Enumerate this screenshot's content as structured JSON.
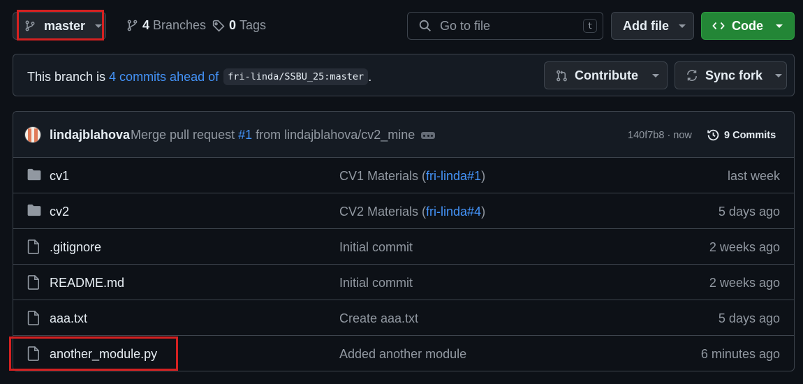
{
  "branch_selector": {
    "name": "master",
    "icon": "git-branch-icon"
  },
  "stats": {
    "branches": {
      "count": "4",
      "label": "Branches",
      "icon": "git-branch-icon"
    },
    "tags": {
      "count": "0",
      "label": "Tags",
      "icon": "tag-icon"
    }
  },
  "search": {
    "placeholder": "Go to file",
    "shortcut": "t",
    "icon": "search-icon"
  },
  "actions": {
    "add_file": "Add file",
    "code": "Code"
  },
  "ahead_banner": {
    "prefix": "This branch is",
    "link": "4 commits ahead of",
    "upstream": "fri-linda/SSBU_25:master",
    "suffix": ".",
    "contribute": "Contribute",
    "sync_fork": "Sync fork"
  },
  "latest_commit": {
    "author": "lindajblahova",
    "message_prefix": "Merge pull request",
    "pr": "#1",
    "message_suffix": "from lindajblahova/cv2_mine",
    "sha_time": "140f7b8 · now",
    "commits_count": "9 Commits"
  },
  "files": [
    {
      "type": "folder",
      "icon": "folder-icon",
      "name": "cv1",
      "msg_prefix": "CV1 Materials (",
      "msg_ref": "fri-linda#1",
      "msg_suffix": ")",
      "date": "last week"
    },
    {
      "type": "folder",
      "icon": "folder-icon",
      "name": "cv2",
      "msg_prefix": "CV2 Materials (",
      "msg_ref": "fri-linda#4",
      "msg_suffix": ")",
      "date": "5 days ago"
    },
    {
      "type": "file",
      "icon": "file-icon",
      "name": ".gitignore",
      "msg_prefix": "Initial commit",
      "msg_ref": "",
      "msg_suffix": "",
      "date": "2 weeks ago"
    },
    {
      "type": "file",
      "icon": "file-icon",
      "name": "README.md",
      "msg_prefix": "Initial commit",
      "msg_ref": "",
      "msg_suffix": "",
      "date": "2 weeks ago"
    },
    {
      "type": "file",
      "icon": "file-icon",
      "name": "aaa.txt",
      "msg_prefix": "Create aaa.txt",
      "msg_ref": "",
      "msg_suffix": "",
      "date": "5 days ago"
    },
    {
      "type": "file",
      "icon": "file-icon",
      "name": "another_module.py",
      "msg_prefix": "Added another module",
      "msg_ref": "",
      "msg_suffix": "",
      "date": "6 minutes ago"
    }
  ],
  "colors": {
    "background": "#0d1117",
    "accent_link": "#4493f8",
    "code_button": "#238636",
    "highlight_box": "#d42121"
  }
}
